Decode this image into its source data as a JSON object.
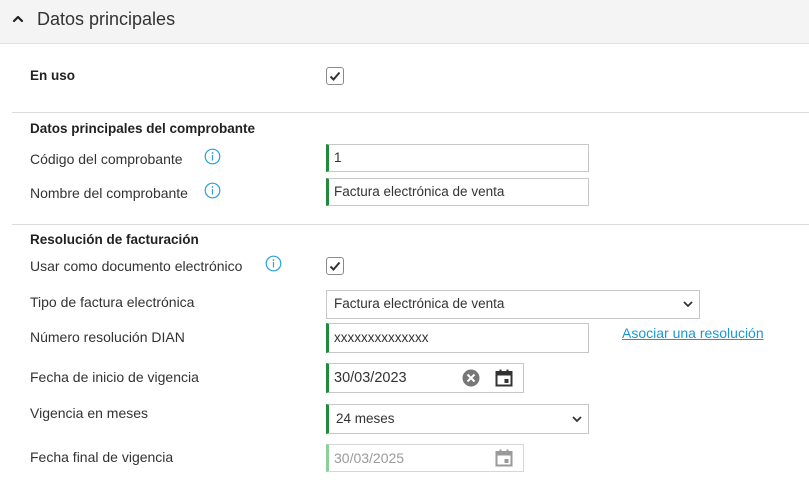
{
  "section": {
    "title": "Datos principales"
  },
  "en_uso": {
    "label": "En uso",
    "checked": true
  },
  "comprobante": {
    "heading": "Datos principales del comprobante",
    "codigo_label": "Código del comprobante",
    "codigo_value": "1",
    "nombre_label": "Nombre del comprobante",
    "nombre_value": "Factura electrónica de venta"
  },
  "resolucion": {
    "heading": "Resolución de facturación",
    "usar_label": "Usar como documento electrónico",
    "usar_checked": true,
    "tipo_label": "Tipo de factura electrónica",
    "tipo_value": "Factura electrónica de venta",
    "numero_label": "Número resolución DIAN",
    "numero_value": "xxxxxxxxxxxxxx",
    "asociar_link": "Asociar una resolución",
    "fecha_inicio_label": "Fecha de inicio de vigencia",
    "fecha_inicio_value": "30/03/2023",
    "vigencia_label": "Vigencia en meses",
    "vigencia_value": "24 meses",
    "fecha_final_label": "Fecha final de vigencia",
    "fecha_final_value": "30/03/2025"
  },
  "colors": {
    "accent_green": "#1e8a3a",
    "link_blue": "#1a98d5",
    "info_blue": "#2a9fd8"
  },
  "icons": [
    "chevron-up-icon",
    "check-icon",
    "info-icon",
    "clear-icon",
    "calendar-icon",
    "chevron-down-icon"
  ]
}
